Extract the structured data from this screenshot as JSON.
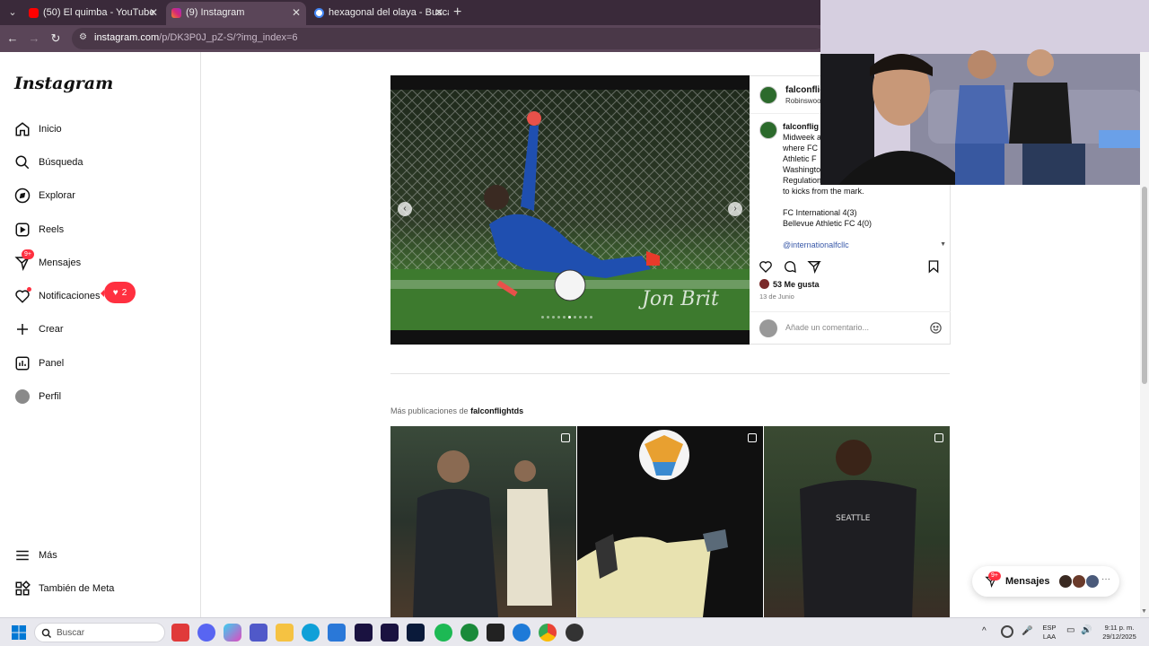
{
  "browser": {
    "tabs": [
      {
        "title": "(50) El quimba - YouTube",
        "icon": "youtube-icon",
        "color": "#ff0000"
      },
      {
        "title": "(9) Instagram",
        "icon": "instagram-icon",
        "color": "#d62976"
      },
      {
        "title": "hexagonal del olaya - Buscar co",
        "icon": "google-icon",
        "color": "#4285f4"
      }
    ],
    "url_host": "instagram.com",
    "url_path": "/p/DK3P0J_pZ-S/?img_index=6"
  },
  "sidebar": {
    "logo": "Instagram",
    "items": [
      {
        "label": "Inicio",
        "icon": "home-icon"
      },
      {
        "label": "Búsqueda",
        "icon": "search-icon"
      },
      {
        "label": "Explorar",
        "icon": "compass-icon"
      },
      {
        "label": "Reels",
        "icon": "reels-icon"
      },
      {
        "label": "Mensajes",
        "icon": "messenger-icon",
        "badge": "9+"
      },
      {
        "label": "Notificaciones",
        "icon": "heart-icon"
      },
      {
        "label": "Crear",
        "icon": "plus-icon"
      },
      {
        "label": "Panel",
        "icon": "chart-icon"
      },
      {
        "label": "Perfil",
        "icon": "avatar"
      }
    ],
    "notifications_count": "2",
    "bottom": [
      {
        "label": "Más",
        "icon": "menu-icon"
      },
      {
        "label": "También de Meta",
        "icon": "meta-icon"
      }
    ]
  },
  "post": {
    "username": "falconflig",
    "location": "Robinswoo",
    "caption_user": "falconflig",
    "caption_lines": [
      "Midweek a",
      "where FC",
      "Athletic F",
      "Washingto",
      "Regulation",
      "to kicks from the mark."
    ],
    "score_lines": [
      "FC International 4(3)",
      "Bellevue Athletic FC 4(0)"
    ],
    "mention": "@internationalfcllc",
    "likes": "53 Me gusta",
    "date": "13 de Junio",
    "comment_placeholder": "Añade un comentario...",
    "watermark": "Jon Brit",
    "carousel_dots": 10,
    "carousel_active": 5
  },
  "more_posts": {
    "prefix": "Más publicaciones de",
    "username": "falconflightds"
  },
  "messages_pill": {
    "label": "Mensajes",
    "badge": "9+"
  },
  "taskbar": {
    "search_label": "Buscar",
    "lang_line1": "ESP",
    "lang_line2": "LAA",
    "time": "9:11 p. m.",
    "date": "29/12/2025"
  }
}
